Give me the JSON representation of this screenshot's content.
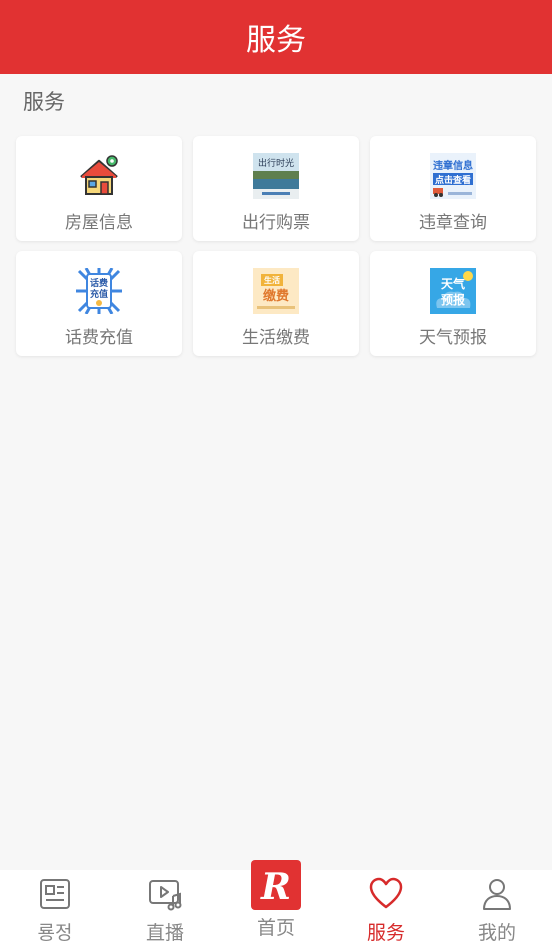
{
  "header": {
    "title": "服务"
  },
  "section": {
    "title": "服务"
  },
  "services": [
    {
      "label": "房屋信息",
      "icon": "house-icon"
    },
    {
      "label": "出行购票",
      "icon": "travel-ticket-icon"
    },
    {
      "label": "违章查询",
      "icon": "violation-query-icon"
    },
    {
      "label": "话费充值",
      "icon": "phone-recharge-icon"
    },
    {
      "label": "生活缴费",
      "icon": "utility-payment-icon"
    },
    {
      "label": "天气预报",
      "icon": "weather-forecast-icon"
    }
  ],
  "tiles": {
    "travel_text": "出行时光",
    "violation_line1": "违章信息",
    "violation_line2": "点击查看",
    "recharge_line1": "话费",
    "recharge_line2": "充值",
    "utility_line1": "生活",
    "utility_line2": "缴费",
    "weather_line1": "天气",
    "weather_line2": "预报"
  },
  "tabbar": {
    "items": [
      {
        "label": "룡정",
        "icon": "news-icon"
      },
      {
        "label": "直播",
        "icon": "live-video-icon"
      },
      {
        "label": "首页",
        "icon": "home-logo-icon",
        "logo_text": "R"
      },
      {
        "label": "服务",
        "icon": "heart-icon",
        "active": true
      },
      {
        "label": "我的",
        "icon": "user-icon"
      }
    ]
  },
  "colors": {
    "brand": "#e13232",
    "active_tab": "#d72b2b",
    "text_muted": "#777777"
  }
}
